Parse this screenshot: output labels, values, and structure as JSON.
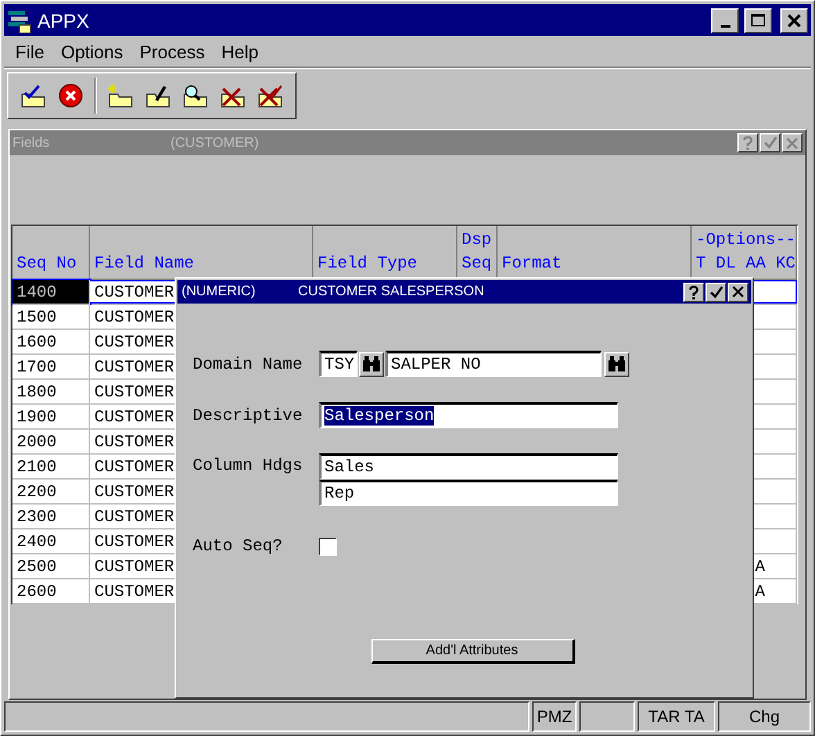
{
  "window": {
    "title": "APPX"
  },
  "menu": [
    {
      "label": "File"
    },
    {
      "label": "Options"
    },
    {
      "label": "Process"
    },
    {
      "label": "Help"
    }
  ],
  "fields_window": {
    "title": "Fields",
    "subtitle": "(CUSTOMER)"
  },
  "table": {
    "columns": [
      {
        "lines": [
          "Seq No"
        ]
      },
      {
        "lines": [
          "Field Name"
        ]
      },
      {
        "lines": [
          "Field Type"
        ]
      },
      {
        "lines": [
          "Dsp",
          "Seq"
        ]
      },
      {
        "lines": [
          "Format"
        ]
      },
      {
        "lines": [
          "-Options--",
          "T DL AA KC"
        ]
      }
    ],
    "rows": [
      {
        "seq": "1400",
        "field_name": "CUSTOMER",
        "selected": true
      },
      {
        "seq": "1500",
        "field_name": "CUSTOMER",
        "selected": false
      },
      {
        "seq": "1600",
        "field_name": "CUSTOMER",
        "selected": false
      },
      {
        "seq": "1700",
        "field_name": "CUSTOMER",
        "selected": false
      },
      {
        "seq": "1800",
        "field_name": "CUSTOMER",
        "selected": false
      },
      {
        "seq": "1900",
        "field_name": "CUSTOMER",
        "selected": false
      },
      {
        "seq": "2000",
        "field_name": "CUSTOMER",
        "selected": false
      },
      {
        "seq": "2100",
        "field_name": "CUSTOMER",
        "selected": false
      },
      {
        "seq": "2200",
        "field_name": "CUSTOMER",
        "selected": false
      },
      {
        "seq": "2300",
        "field_name": "CUSTOMER",
        "selected": false
      },
      {
        "seq": "2400",
        "field_name": "CUSTOMER",
        "selected": false
      },
      {
        "seq": "2500",
        "field_name": "CUSTOMER",
        "options": "A",
        "selected": false
      },
      {
        "seq": "2600",
        "field_name": "CUSTOMER",
        "options": "A",
        "selected": false
      }
    ]
  },
  "dialog": {
    "type": "(NUMERIC)",
    "title": "CUSTOMER SALESPERSON",
    "domain_name": {
      "label": "Domain Name",
      "prefix": "TSY",
      "value": "SALPER NO"
    },
    "descriptive": {
      "label": "Descriptive",
      "value": "Salesperson",
      "selected": true
    },
    "column_hdgs": {
      "label": "Column Hdgs",
      "values": [
        "Sales",
        "Rep"
      ]
    },
    "auto_seq": {
      "label": "Auto Seq?",
      "checked": false
    },
    "button": "Add'l Attributes"
  },
  "status_bar": [
    {
      "kind": "wide"
    },
    {
      "kind": "panel",
      "text": "PMZ"
    },
    {
      "kind": "panel"
    },
    {
      "kind": "panel",
      "text": "TAR TA"
    },
    {
      "kind": "end",
      "text": "Chg"
    }
  ]
}
